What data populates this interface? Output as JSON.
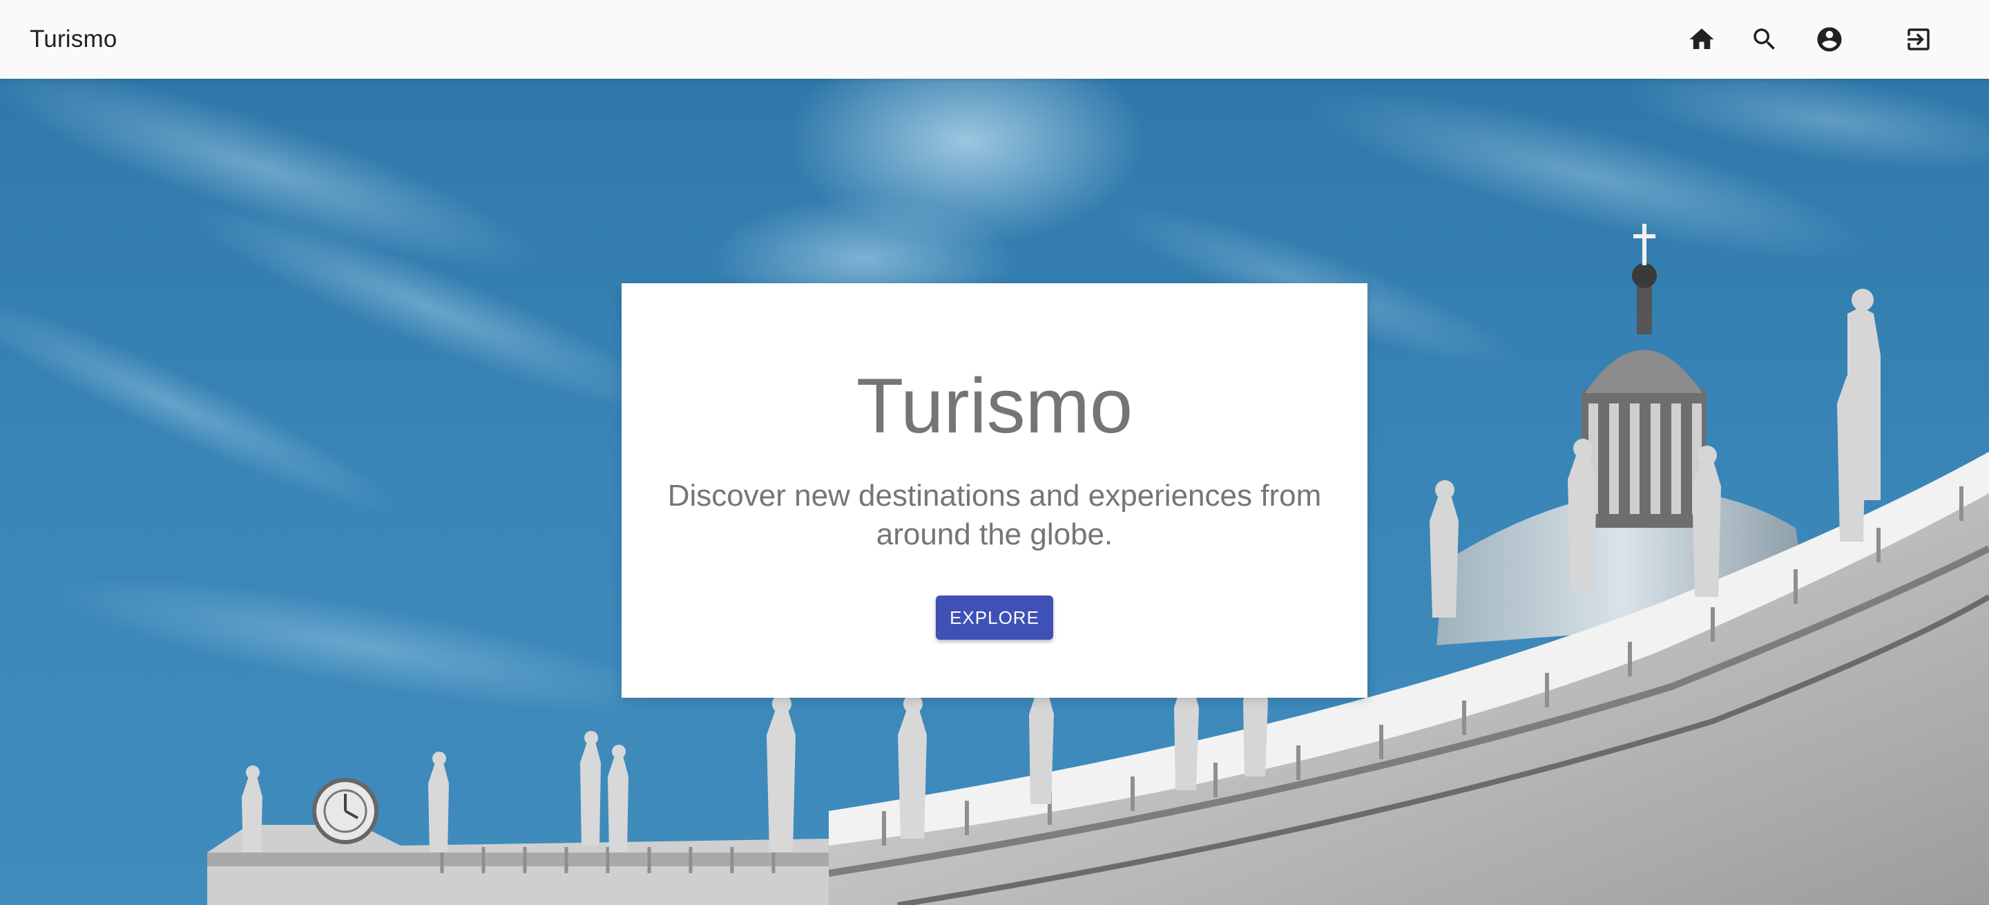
{
  "toolbar": {
    "title": "Turismo",
    "icons": {
      "home": "home-icon",
      "search": "search-icon",
      "account": "account-circle-icon",
      "login": "login-icon"
    }
  },
  "hero": {
    "card": {
      "title": "Turismo",
      "subtitle": "Discover new destinations and experiences from around the globe.",
      "button_label": "EXPLORE"
    }
  },
  "colors": {
    "primary": "#3f51b5",
    "toolbar_bg": "#fafafa",
    "sky": "#3a83b4",
    "text_muted": "#757575"
  }
}
